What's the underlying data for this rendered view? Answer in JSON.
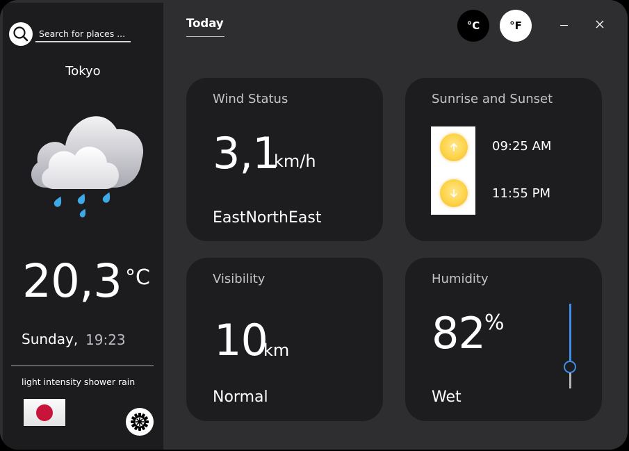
{
  "search": {
    "placeholder": "Search for places ..."
  },
  "location": {
    "city": "Tokyo"
  },
  "current": {
    "temperature": "20,3",
    "temperature_unit": "°C",
    "day": "Sunday,",
    "time": "19:23",
    "description": "light intensity shower rain",
    "weather_icon": "cloud-rain-icon",
    "flag": "japan-flag-icon"
  },
  "header": {
    "tab_today": "Today",
    "unit_celsius": "°C",
    "unit_fahrenheit": "°F"
  },
  "cards": {
    "wind": {
      "title": "Wind Status",
      "value": "3,1",
      "unit": "km/h",
      "direction": "EastNorthEast"
    },
    "sun": {
      "title": "Sunrise and Sunset",
      "sunrise": "09:25 AM",
      "sunset": "11:55 PM"
    },
    "visibility": {
      "title": "Visibility",
      "value": "10",
      "unit": "km",
      "status": "Normal"
    },
    "humidity": {
      "title": "Humidity",
      "value": "82",
      "unit": "%",
      "status": "Wet",
      "level_percent": 82
    }
  },
  "colors": {
    "background": "#2e2e31",
    "sidebar": "#1c1c1f",
    "card": "#1d1d20",
    "accent_blue": "#3d8ee8",
    "sun_yellow": "#fdd44a",
    "flag_red": "#c8143a"
  }
}
